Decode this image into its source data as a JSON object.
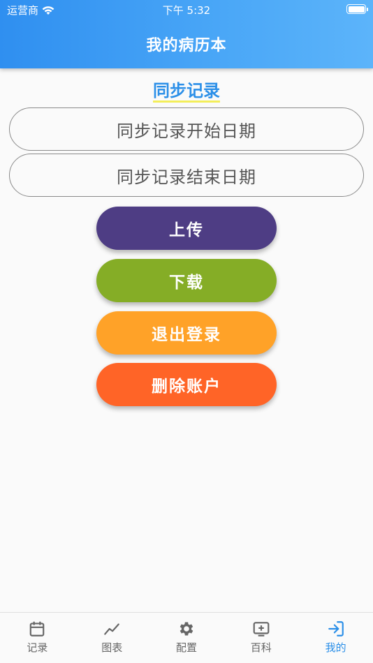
{
  "status": {
    "carrier": "运营商",
    "time": "下午 5:32"
  },
  "header": {
    "title": "我的病历本"
  },
  "sync": {
    "title": "同步记录",
    "start_date": "同步记录开始日期",
    "end_date": "同步记录结束日期"
  },
  "actions": {
    "upload": "上传",
    "download": "下载",
    "logout": "退出登录",
    "delete_account": "删除账户"
  },
  "colors": {
    "upload": "#4e3d84",
    "download": "#85ad26",
    "logout": "#ffa228",
    "delete_account": "#ff6427",
    "accent": "#2b8fe8"
  },
  "tabs": [
    {
      "label": "记录",
      "icon": "calendar-icon"
    },
    {
      "label": "图表",
      "icon": "chart-line-icon"
    },
    {
      "label": "配置",
      "icon": "gear-icon"
    },
    {
      "label": "百科",
      "icon": "tv-plus-icon"
    },
    {
      "label": "我的",
      "icon": "login-icon",
      "active": true
    }
  ]
}
